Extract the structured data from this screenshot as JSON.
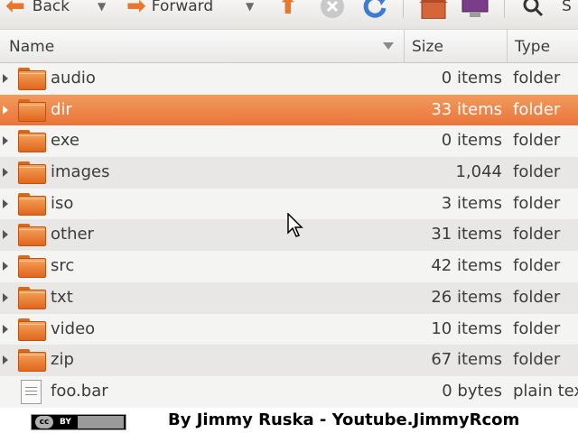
{
  "toolbar": {
    "back_label": "Back",
    "forward_label": "Forward",
    "search_label": "S"
  },
  "columns": {
    "name": "Name",
    "size": "Size",
    "type": "Type"
  },
  "rows": [
    {
      "name": "audio",
      "size": "0 items",
      "type": "folder",
      "kind": "folder"
    },
    {
      "name": "dir",
      "size": "33 items",
      "type": "folder",
      "kind": "folder",
      "selected": true
    },
    {
      "name": "exe",
      "size": "0 items",
      "type": "folder",
      "kind": "folder"
    },
    {
      "name": "images",
      "size": "1,044 items",
      "type": "folder",
      "kind": "folder"
    },
    {
      "name": "iso",
      "size": "3 items",
      "type": "folder",
      "kind": "folder"
    },
    {
      "name": "other",
      "size": "31 items",
      "type": "folder",
      "kind": "folder"
    },
    {
      "name": "src",
      "size": "42 items",
      "type": "folder",
      "kind": "folder"
    },
    {
      "name": "txt",
      "size": "26 items",
      "type": "folder",
      "kind": "folder"
    },
    {
      "name": "video",
      "size": "10 items",
      "type": "folder",
      "kind": "folder"
    },
    {
      "name": "zip",
      "size": "67 items",
      "type": "folder",
      "kind": "folder"
    },
    {
      "name": "foo.bar",
      "size": "0 bytes",
      "type": "plain tex",
      "kind": "file"
    }
  ],
  "footer": {
    "license": "cc",
    "license_by": "BY",
    "credit": "By Jimmy Ruska - Youtube.JimmyRcom"
  },
  "colors": {
    "selection": "#e9743a",
    "folder": "#e8762b"
  }
}
